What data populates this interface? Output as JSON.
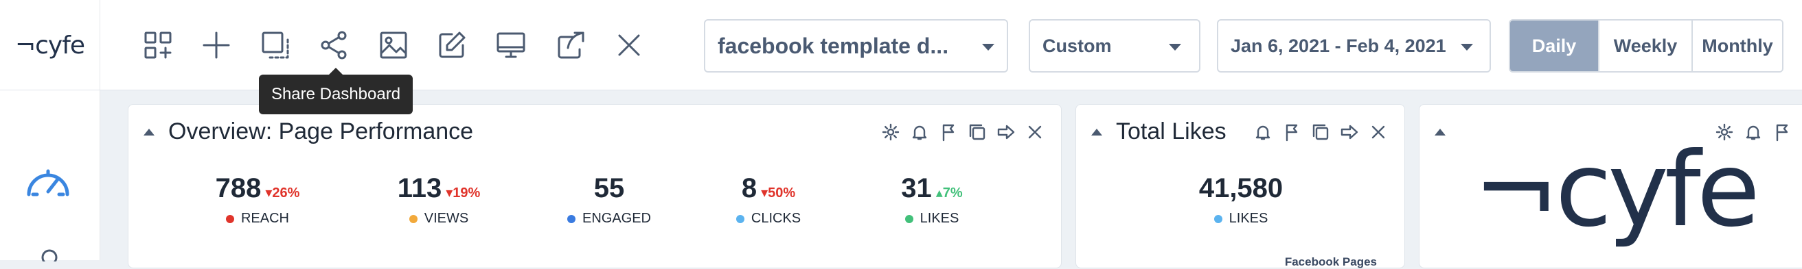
{
  "logo": {
    "text": "¬cyfe"
  },
  "toolbar": {
    "icons": [
      "add-widget-icon",
      "plus-icon",
      "copy-dashboard-icon",
      "share-icon",
      "image-icon",
      "edit-icon",
      "monitor-icon",
      "export-icon",
      "close-icon"
    ],
    "tooltip": "Share Dashboard"
  },
  "dashboard_select": {
    "value": "facebook template d..."
  },
  "range_select": {
    "value": "Custom"
  },
  "date_select": {
    "value": "Jan 6, 2021 - Feb 4, 2021"
  },
  "granularity": {
    "options": [
      "Daily",
      "Weekly",
      "Monthly"
    ],
    "selected": "Daily"
  },
  "colors": {
    "accent": "#94a5bd",
    "down": "#e0342b",
    "up": "#42c07a",
    "text_muted": "#4a5a72"
  },
  "widgets": {
    "overview": {
      "title": "Overview: Page Performance",
      "metrics": [
        {
          "value": "788",
          "change": "▾26%",
          "direction": "down",
          "label": "REACH",
          "color": "#e0342b"
        },
        {
          "value": "113",
          "change": "▾19%",
          "direction": "down",
          "label": "VIEWS",
          "color": "#f2a93b"
        },
        {
          "value": "55",
          "change": "",
          "direction": "none",
          "label": "ENGAGED",
          "color": "#3a7be0"
        },
        {
          "value": "8",
          "change": "▾50%",
          "direction": "down",
          "label": "CLICKS",
          "color": "#5bb3ef"
        },
        {
          "value": "31",
          "change": "▴7%",
          "direction": "up",
          "label": "LIKES",
          "color": "#42c07a"
        }
      ]
    },
    "total_likes": {
      "title": "Total Likes",
      "metric": {
        "value": "41,580",
        "label": "LIKES",
        "color": "#5bb3ef"
      },
      "footer": "Facebook Pages"
    },
    "logo_widget": {
      "logo_text": "¬cyfe"
    }
  }
}
